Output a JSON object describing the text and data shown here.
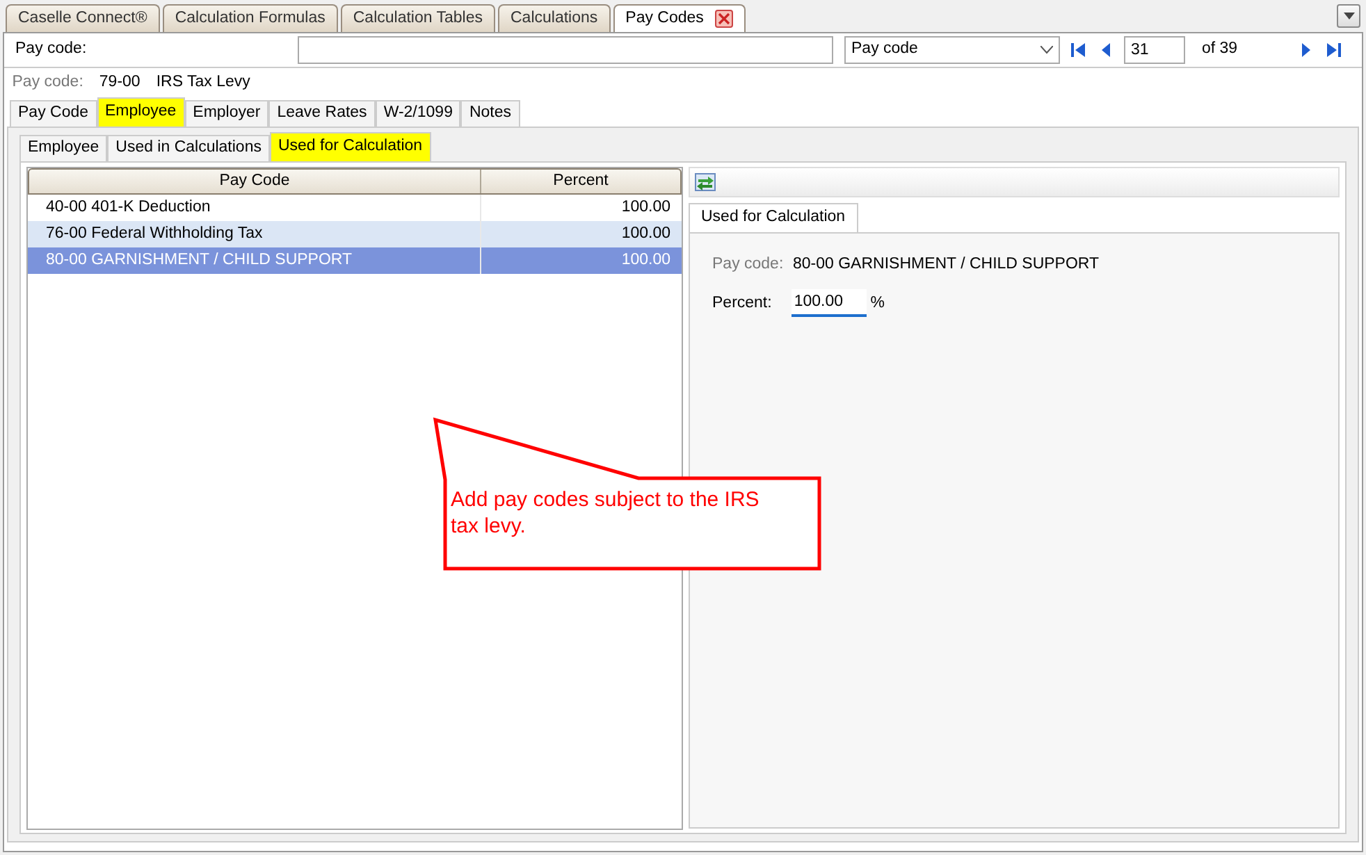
{
  "doc_tabs": [
    {
      "label": "Caselle Connect®",
      "selected": false,
      "closable": false
    },
    {
      "label": "Calculation Formulas",
      "selected": false,
      "closable": false
    },
    {
      "label": "Calculation Tables",
      "selected": false,
      "closable": false
    },
    {
      "label": "Calculations",
      "selected": false,
      "closable": false
    },
    {
      "label": "Pay Codes",
      "selected": true,
      "closable": true
    }
  ],
  "search_bar": {
    "label": "Pay code:",
    "search_by": "Pay code",
    "record": "31",
    "record_total": "of 39"
  },
  "record": {
    "label": "Pay code:",
    "code": "79-00",
    "name": "IRS Tax Levy"
  },
  "tabs": [
    {
      "label": "Pay Code",
      "selected": false,
      "highlighted": false
    },
    {
      "label": "Employee",
      "selected": true,
      "highlighted": true
    },
    {
      "label": "Employer",
      "selected": false,
      "highlighted": false
    },
    {
      "label": "Leave Rates",
      "selected": false,
      "highlighted": false
    },
    {
      "label": "W-2/1099",
      "selected": false,
      "highlighted": false
    },
    {
      "label": "Notes",
      "selected": false,
      "highlighted": false
    }
  ],
  "sub_tabs": [
    {
      "label": "Employee",
      "selected": false,
      "highlighted": false
    },
    {
      "label": "Used in Calculations",
      "selected": false,
      "highlighted": false
    },
    {
      "label": "Used for Calculation",
      "selected": true,
      "highlighted": true
    }
  ],
  "table": {
    "columns": [
      "Pay Code",
      "Percent"
    ],
    "rows": [
      {
        "pay_code": "40-00 401-K Deduction",
        "percent": "100.00",
        "selected": false,
        "hovered": false
      },
      {
        "pay_code": "76-00 Federal Withholding Tax",
        "percent": "100.00",
        "selected": false,
        "hovered": true
      },
      {
        "pay_code": "80-00 GARNISHMENT / CHILD SUPPORT",
        "percent": "100.00",
        "selected": true,
        "hovered": false
      }
    ]
  },
  "detail": {
    "tab": "Used for Calculation",
    "pay_code_label": "Pay code:",
    "pay_code": "80-00 GARNISHMENT / CHILD SUPPORT",
    "percent_label": "Percent:",
    "percent": "100.00",
    "percent_unit": "%"
  },
  "callout": {
    "text": "Add pay codes subject to the IRS tax levy."
  }
}
